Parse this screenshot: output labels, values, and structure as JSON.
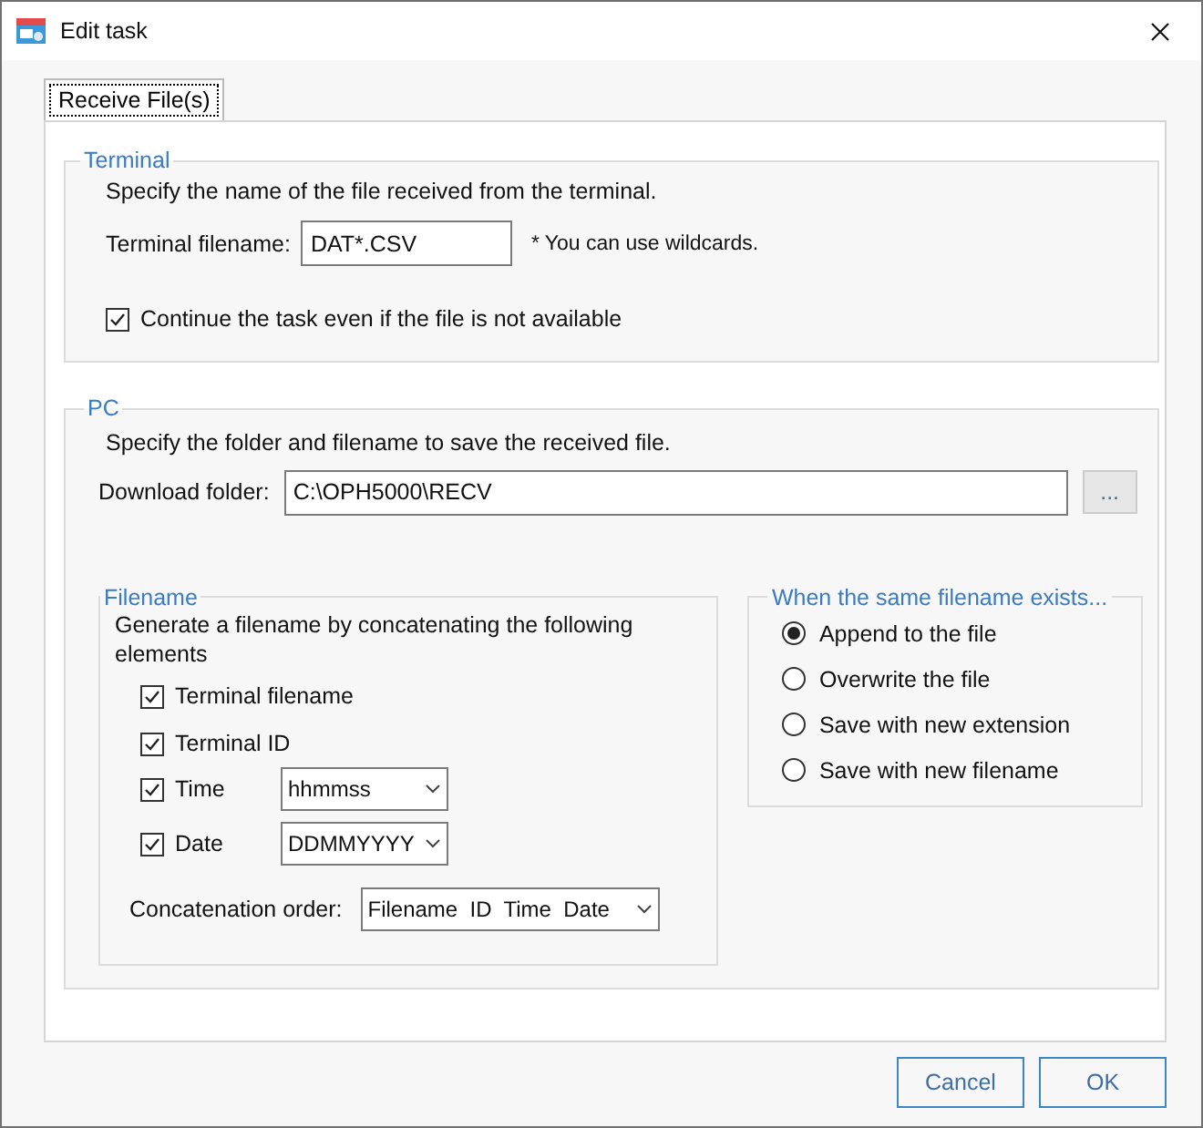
{
  "window": {
    "title": "Edit task"
  },
  "tabs": [
    {
      "label": "Receive File(s)",
      "selected": true
    }
  ],
  "terminal": {
    "legend": "Terminal",
    "description": "Specify the name of the file received from the terminal.",
    "filename_label": "Terminal filename:",
    "filename_value": "DAT*.CSV",
    "hint": "* You can use wildcards.",
    "continue": {
      "label": "Continue the task even if the file is not available",
      "checked": true
    }
  },
  "pc": {
    "legend": "PC",
    "description": "Specify the folder and filename to save the received file.",
    "folder_label": "Download folder:",
    "folder_value": "C:\\OPH5000\\RECV",
    "browse": "...",
    "filename": {
      "legend": "Filename",
      "description": "Generate a filename by concatenating the following elements",
      "elements": [
        {
          "label": "Terminal filename",
          "checked": true
        },
        {
          "label": "Terminal ID",
          "checked": true
        },
        {
          "label": "Time",
          "checked": true,
          "format": "hhmmss"
        },
        {
          "label": "Date",
          "checked": true,
          "format": "DDMMYYYY"
        }
      ],
      "order_label": "Concatenation order:",
      "order_value": "Filename  ID  Time  Date"
    },
    "exists": {
      "legend": "When the same filename exists...",
      "options": [
        {
          "label": "Append to the file",
          "selected": true
        },
        {
          "label": "Overwrite the file",
          "selected": false
        },
        {
          "label": "Save with new extension",
          "selected": false
        },
        {
          "label": "Save with new filename",
          "selected": false
        }
      ]
    }
  },
  "buttons": [
    "Cancel",
    "OK"
  ]
}
